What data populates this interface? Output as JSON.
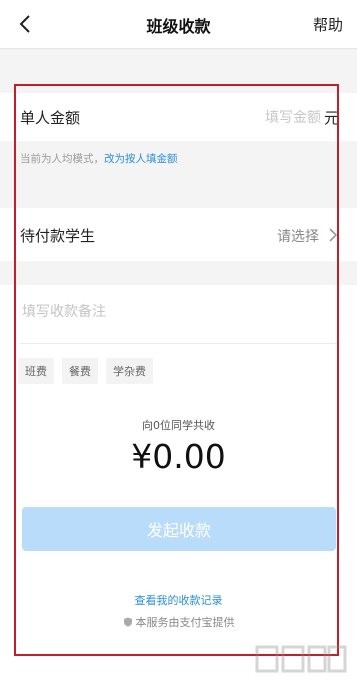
{
  "header": {
    "title": "班级收款",
    "help_label": "帮助"
  },
  "amount": {
    "label": "单人金额",
    "placeholder": "填写金额",
    "unit": "元"
  },
  "mode": {
    "text": "当前为人均模式，",
    "link": "改为按人填金额"
  },
  "students": {
    "label": "待付款学生",
    "select_text": "请选择"
  },
  "memo": {
    "placeholder": "填写收款备注",
    "tags": [
      "班费",
      "餐费",
      "学杂费"
    ]
  },
  "summary": {
    "note": "向0位同学共收",
    "amount": "¥0.00"
  },
  "actions": {
    "submit_label": "发起收款",
    "history_link": "查看我的收款记录",
    "provider_text": "本服务由支付宝提供"
  },
  "colors": {
    "accent": "#2b8fd8",
    "button_disabled": "#b9dcfb",
    "highlight_frame": "#c21f2c"
  }
}
